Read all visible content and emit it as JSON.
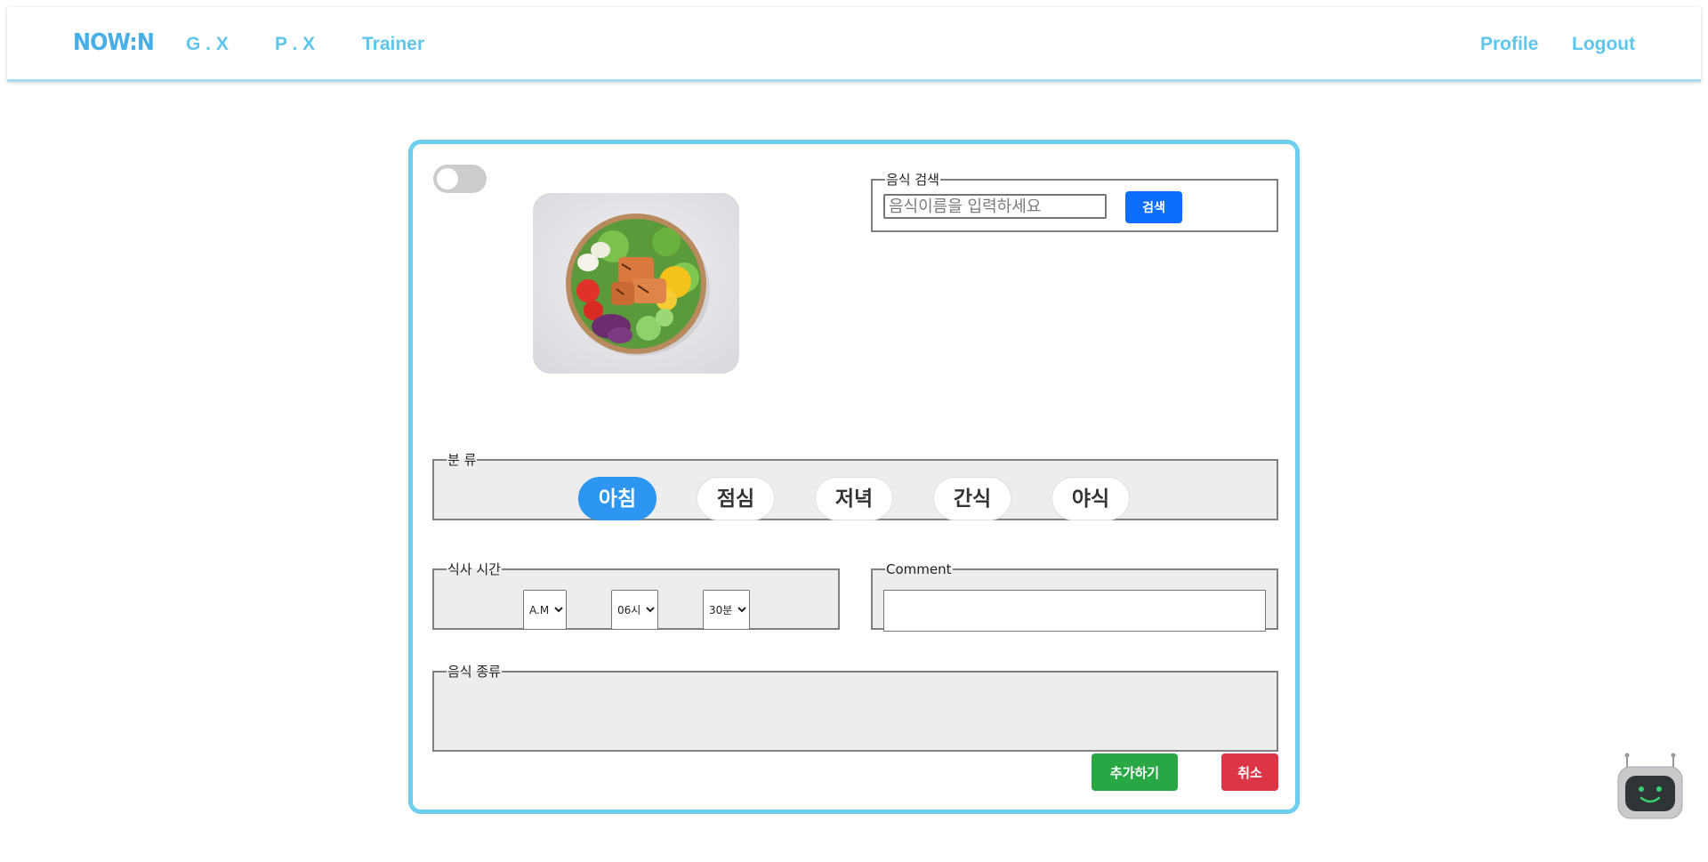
{
  "navbar": {
    "logo": "NOW:N",
    "links": [
      "G . X",
      "P . X",
      "Trainer"
    ],
    "right_links": [
      "Profile",
      "Logout"
    ]
  },
  "search": {
    "legend": "음식 검색",
    "placeholder": "음식이름을 입력하세요",
    "button_label": "검색"
  },
  "category": {
    "legend": "분 류",
    "options": [
      "아침",
      "점심",
      "저녁",
      "간식",
      "야식"
    ],
    "selected": "아침"
  },
  "meal_time": {
    "legend": "식사 시간",
    "ampm": "A.M",
    "hour": "06시",
    "minute": "30분"
  },
  "comment": {
    "legend": "Comment",
    "value": ""
  },
  "food_type": {
    "legend": "음식 종류"
  },
  "actions": {
    "add_label": "추가하기",
    "cancel_label": "취소"
  },
  "colors": {
    "accent": "#5ec6ec",
    "card_border": "#6fcdee",
    "primary": "#0d6efd",
    "meal_active": "#2c96f0",
    "success": "#28a745",
    "danger": "#dc3545"
  },
  "icons": {
    "chatbot": "robot-icon"
  }
}
